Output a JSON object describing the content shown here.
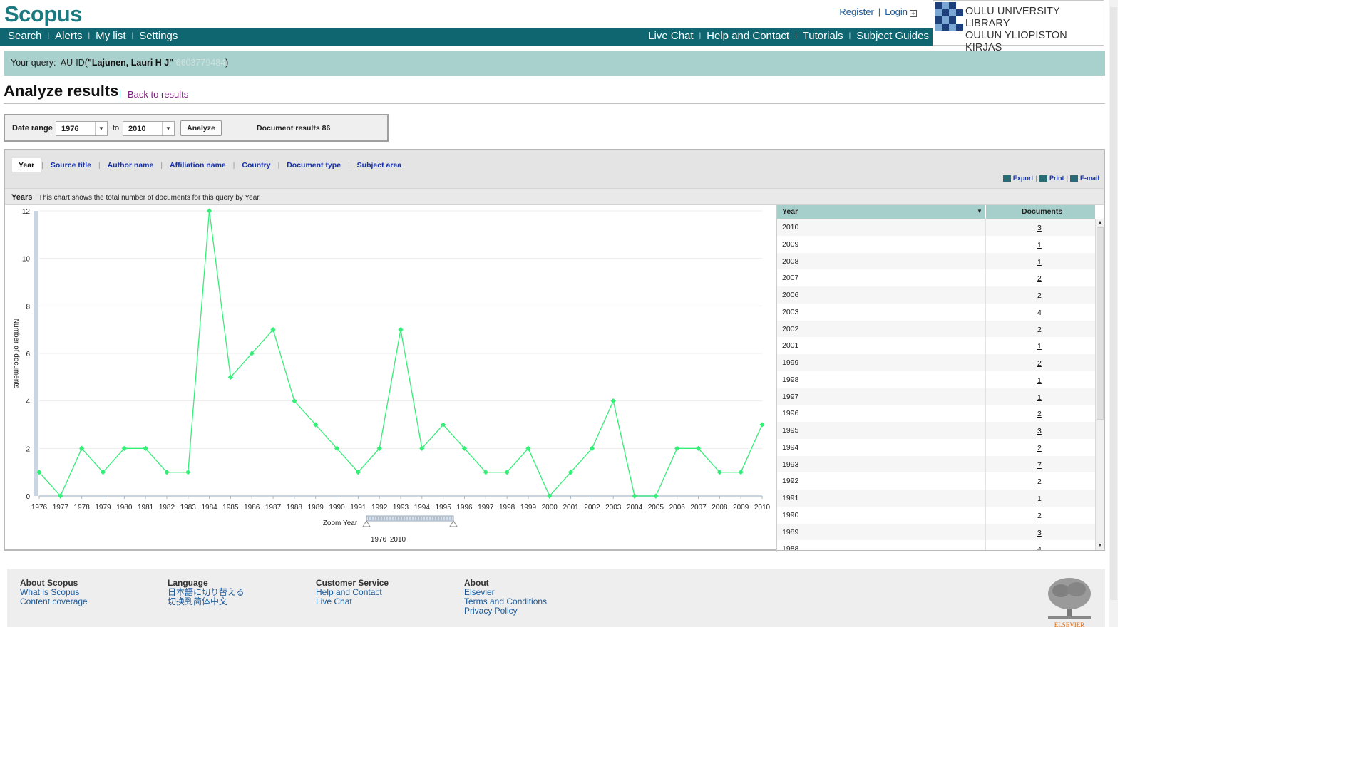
{
  "header": {
    "logo": "Scopus",
    "register": "Register",
    "login": "Login",
    "library_line1": "OULU UNIVERSITY LIBRARY",
    "library_line2": "OULUN YLIOPISTON KIRJAS"
  },
  "nav": {
    "left": [
      "Search",
      "Alerts",
      "My list",
      "Settings"
    ],
    "right": [
      "Live Chat",
      "Help and Contact",
      "Tutorials",
      "Subject Guides"
    ]
  },
  "query": {
    "label": "Your query:",
    "prefix": "AU-ID(",
    "author": "\"Lajunen, Lauri H J\"",
    "id": "6603779484",
    "suffix": ")"
  },
  "page": {
    "title": "Analyze results",
    "back_link": "Back to results"
  },
  "date_range": {
    "label": "Date range",
    "from": "1976",
    "to_label": "to",
    "to": "2010",
    "analyze_button": "Analyze",
    "document_results": "Document results 86"
  },
  "tabs": [
    "Year",
    "Source title",
    "Author name",
    "Affiliation name",
    "Country",
    "Document type",
    "Subject area"
  ],
  "actions": {
    "export": "Export",
    "print": "Print",
    "email": "E-mail"
  },
  "years_bar": {
    "title": "Years",
    "description": "This chart shows the total number of documents for this query by Year."
  },
  "chart_data": {
    "type": "line",
    "x": [
      1976,
      1977,
      1978,
      1979,
      1980,
      1981,
      1982,
      1983,
      1984,
      1985,
      1986,
      1987,
      1988,
      1989,
      1990,
      1991,
      1992,
      1993,
      1994,
      1995,
      1996,
      1997,
      1998,
      1999,
      2000,
      2001,
      2002,
      2003,
      2004,
      2005,
      2006,
      2007,
      2008,
      2009,
      2010
    ],
    "values": [
      1,
      0,
      2,
      1,
      2,
      2,
      1,
      1,
      12,
      5,
      6,
      7,
      4,
      3,
      2,
      1,
      2,
      7,
      2,
      3,
      2,
      1,
      1,
      2,
      0,
      1,
      2,
      4,
      0,
      0,
      2,
      2,
      1,
      1,
      3
    ],
    "ylabel": "Number of documents",
    "ylim": [
      0,
      12
    ],
    "yticks": [
      0,
      2,
      4,
      6,
      8,
      10,
      12
    ],
    "line_color": "#33ee77",
    "zoom_label": "Zoom Year",
    "zoom_from": "1976",
    "zoom_to": "2010"
  },
  "table": {
    "col_year": "Year",
    "col_docs": "Documents",
    "rows": [
      {
        "year": "2010",
        "docs": "3"
      },
      {
        "year": "2009",
        "docs": "1"
      },
      {
        "year": "2008",
        "docs": "1"
      },
      {
        "year": "2007",
        "docs": "2"
      },
      {
        "year": "2006",
        "docs": "2"
      },
      {
        "year": "2003",
        "docs": "4"
      },
      {
        "year": "2002",
        "docs": "2"
      },
      {
        "year": "2001",
        "docs": "1"
      },
      {
        "year": "1999",
        "docs": "2"
      },
      {
        "year": "1998",
        "docs": "1"
      },
      {
        "year": "1997",
        "docs": "1"
      },
      {
        "year": "1996",
        "docs": "2"
      },
      {
        "year": "1995",
        "docs": "3"
      },
      {
        "year": "1994",
        "docs": "2"
      },
      {
        "year": "1993",
        "docs": "7"
      },
      {
        "year": "1992",
        "docs": "2"
      },
      {
        "year": "1991",
        "docs": "1"
      },
      {
        "year": "1990",
        "docs": "2"
      },
      {
        "year": "1989",
        "docs": "3"
      },
      {
        "year": "1988",
        "docs": "4"
      }
    ]
  },
  "footer": {
    "about_scopus": {
      "heading": "About Scopus",
      "links": [
        "What is Scopus",
        "Content coverage"
      ]
    },
    "language": {
      "heading": "Language",
      "links": [
        "日本語に切り替える",
        "切换到简体中文"
      ]
    },
    "customer_service": {
      "heading": "Customer Service",
      "links": [
        "Help and Contact",
        "Live Chat"
      ]
    },
    "about": {
      "heading": "About",
      "links": [
        "Elsevier",
        "Terms and Conditions",
        "Privacy Policy"
      ]
    },
    "elsevier_logo": "ELSEVIER"
  }
}
